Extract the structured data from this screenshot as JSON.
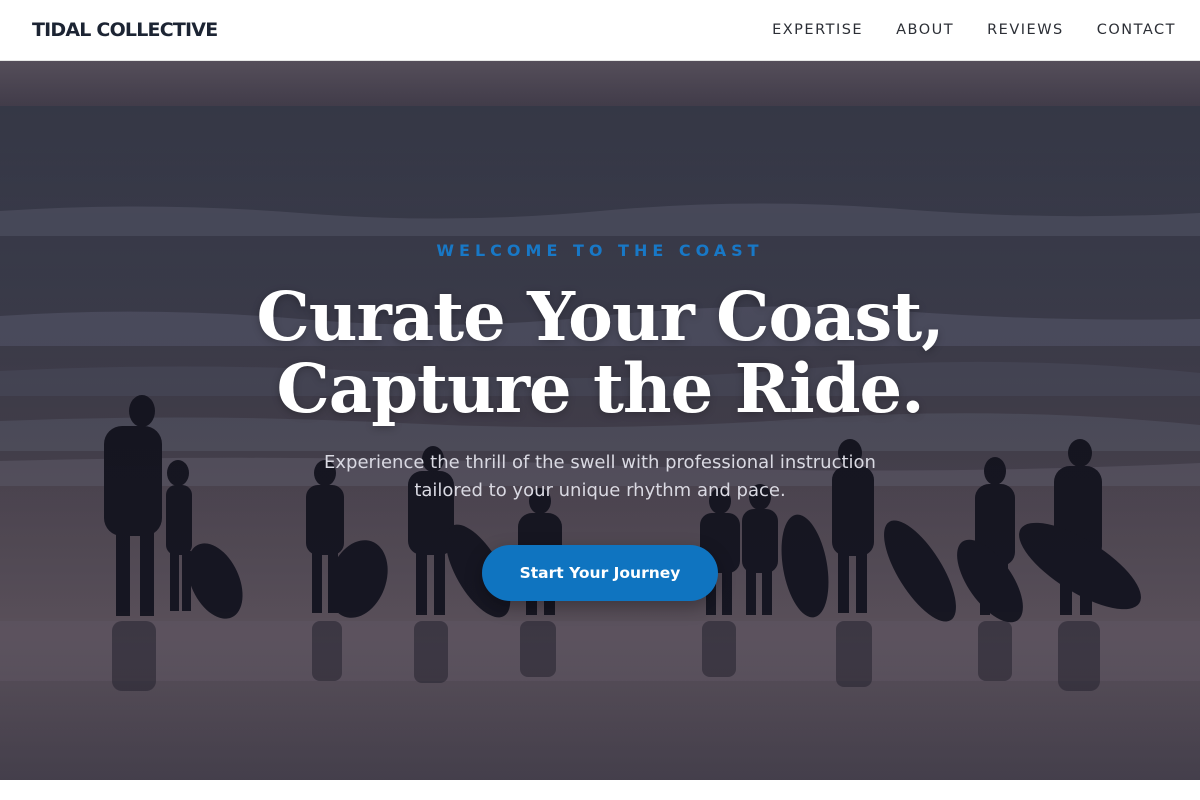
{
  "navbar": {
    "brand": "TIDAL COLLECTIVE",
    "links": [
      "EXPERTISE",
      "ABOUT",
      "REVIEWS",
      "CONTACT"
    ]
  },
  "hero": {
    "eyebrow": "WELCOME TO THE COAST",
    "headline_line1": "Curate Your Coast,",
    "headline_line2": "Capture the Ride.",
    "subtext": "Experience the thrill of the swell with professional instruction tailored to your unique rhythm and pace.",
    "cta_label": "Start Your Journey",
    "background_image": "surfers-silhouette-beach-photo"
  },
  "colors": {
    "accent": "#1878c6",
    "button": "#0f74c0",
    "brand_text": "#1c2433",
    "hero_overlay": "#3b3644"
  }
}
